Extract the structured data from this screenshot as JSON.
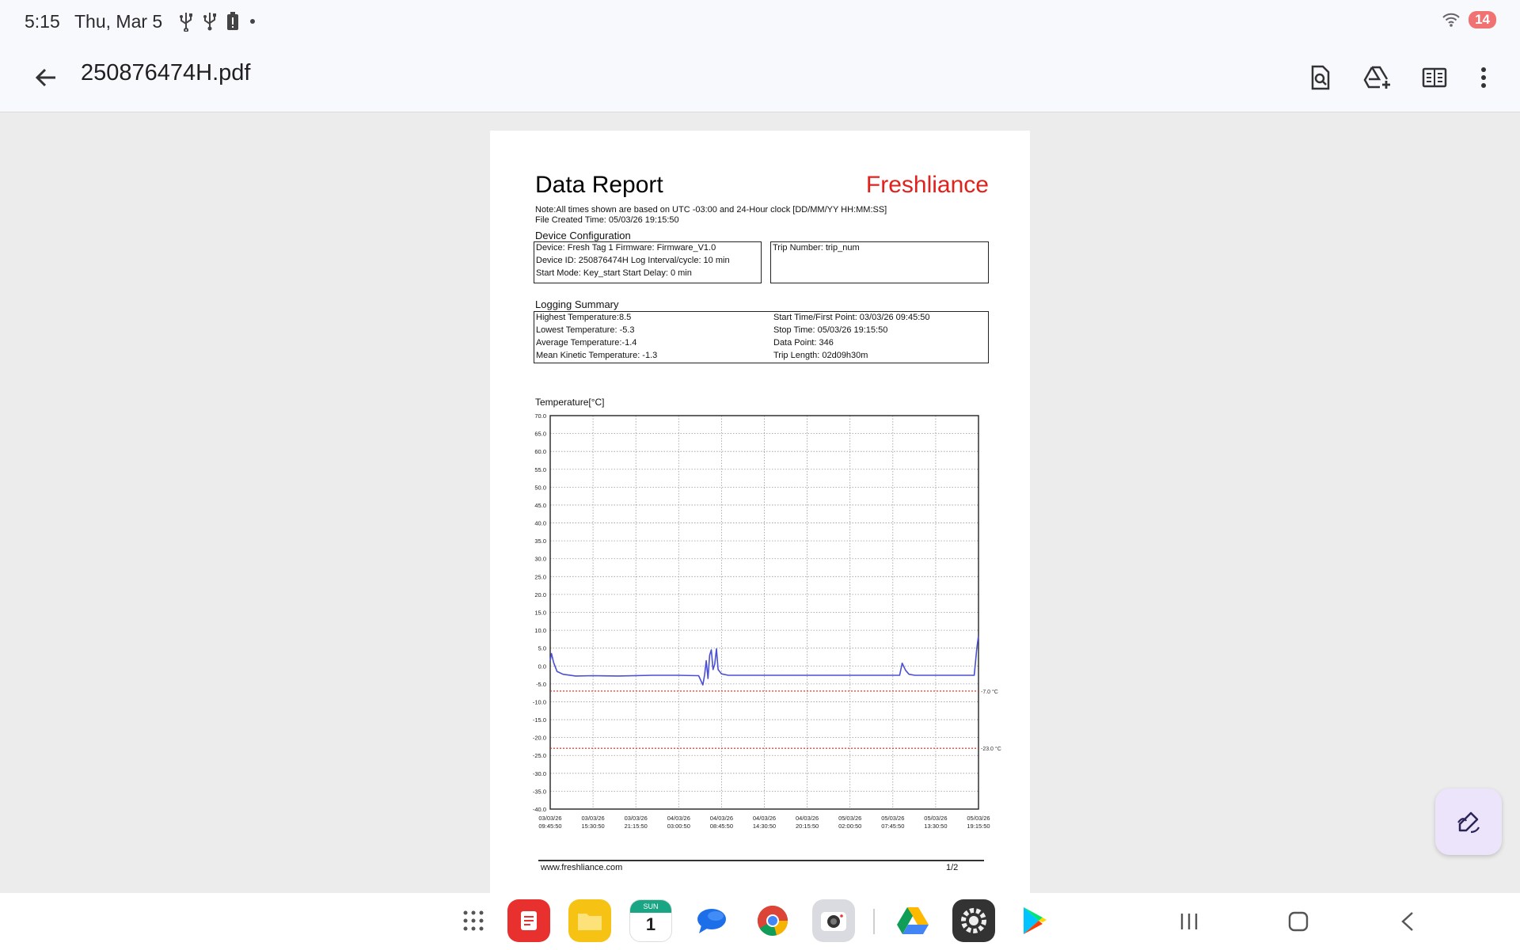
{
  "status": {
    "time": "5:15",
    "date": "Thu, Mar 5",
    "battery": "14",
    "icons": [
      "usb-icon",
      "usb-icon",
      "battery-alert-icon",
      "dot-icon",
      "wifi-icon"
    ]
  },
  "toolbar": {
    "title": "250876474H.pdf",
    "actions": [
      "search-in-document-icon",
      "add-to-drive-icon",
      "reading-mode-icon",
      "more-vert-icon"
    ]
  },
  "pdf": {
    "title": "Data Report",
    "brand": "Freshliance",
    "brand_color": "#e0211c",
    "note": "Note:All times shown are based on UTC -03:00   and 24-Hour clock  [DD/MM/YY HH:MM:SS]",
    "file_created": "File Created Time: 05/03/26 19:15:50",
    "device_config_label": "Device Configuration",
    "device_lines": [
      "Device:  Fresh Tag 1     Firmware: Firmware_V1.0",
      "Device ID: 250876474H Log Interval/cycle: 10 min",
      "Start Mode: Key_start    Start Delay:  0 min"
    ],
    "trip_number": "Trip Number: trip_num",
    "logging_label": "Logging Summary",
    "logging_left": [
      "Highest Temperature:8.5",
      "Lowest Temperature: -5.3",
      "Average Temperature:-1.4",
      "Mean Kinetic Temperature: -1.3"
    ],
    "logging_right": [
      "Start Time/First Point: 03/03/26 09:45:50",
      "Stop Time: 05/03/26 19:15:50",
      "Data Point: 346",
      "Trip Length:  02d09h30m"
    ],
    "footer_url": "www.freshliance.com",
    "footer_page": "1/2"
  },
  "chart_data": {
    "type": "line",
    "ylabel": "Temperature[°C]",
    "ylim": [
      -40,
      70
    ],
    "yticks": [
      "70.0",
      "65.0",
      "60.0",
      "55.0",
      "50.0",
      "45.0",
      "40.0",
      "35.0",
      "30.0",
      "25.0",
      "20.0",
      "15.0",
      "10.0",
      "5.0",
      "0.0",
      "-5.0",
      "-10.0",
      "-15.0",
      "-20.0",
      "-25.0",
      "-30.0",
      "-35.0",
      "-40.0"
    ],
    "xticks": [
      [
        "03/03/26",
        "09:45:50"
      ],
      [
        "03/03/26",
        "15:30:50"
      ],
      [
        "03/03/26",
        "21:15:50"
      ],
      [
        "04/03/26",
        "03:00:50"
      ],
      [
        "04/03/26",
        "08:45:50"
      ],
      [
        "04/03/26",
        "14:30:50"
      ],
      [
        "04/03/26",
        "20:15:50"
      ],
      [
        "05/03/26",
        "02:00:50"
      ],
      [
        "05/03/26",
        "07:45:50"
      ],
      [
        "05/03/26",
        "13:30:50"
      ],
      [
        "05/03/26",
        "19:15:50"
      ]
    ],
    "grid": true,
    "series_color": "#4a4fd4",
    "limit_color": "#e0211c",
    "limits": [
      {
        "value": -7.0,
        "label": "-7.0  °C"
      },
      {
        "value": -23.0,
        "label": "-23.0 °C"
      }
    ],
    "series": [
      {
        "x": [
          0,
          0.15,
          0.4,
          0.8,
          1.5,
          3,
          5,
          8,
          12,
          15,
          17.5,
          18.0,
          18.2,
          18.4,
          18.6,
          18.8,
          19.0,
          19.2,
          19.4,
          19.6,
          19.8,
          20.2,
          21,
          25,
          30,
          35,
          40,
          41.2,
          41.5,
          41.9,
          42.3,
          43,
          46,
          50,
          50.3,
          50.5
        ],
        "y": [
          1.5,
          3.5,
          1,
          -1.5,
          -2.3,
          -2.8,
          -2.7,
          -2.8,
          -2.6,
          -2.6,
          -2.7,
          -5.3,
          -2.5,
          1.5,
          -3.5,
          3,
          4.5,
          -1,
          0.5,
          4.8,
          -1,
          -2.2,
          -2.6,
          -2.6,
          -2.6,
          -2.6,
          -2.6,
          -2.6,
          0.8,
          -1.2,
          -2.3,
          -2.6,
          -2.6,
          -2.6,
          5,
          8.5
        ]
      }
    ]
  },
  "dock": {
    "apps": [
      "app-drawer-icon",
      "notes-app-icon",
      "files-app-icon",
      "calendar-app-icon",
      "messages-app-icon",
      "chrome-app-icon",
      "camera-app-icon",
      "drive-app-icon",
      "settings-app-icon",
      "play-store-app-icon"
    ],
    "calendar_day": "SUN",
    "calendar_date": "1"
  }
}
